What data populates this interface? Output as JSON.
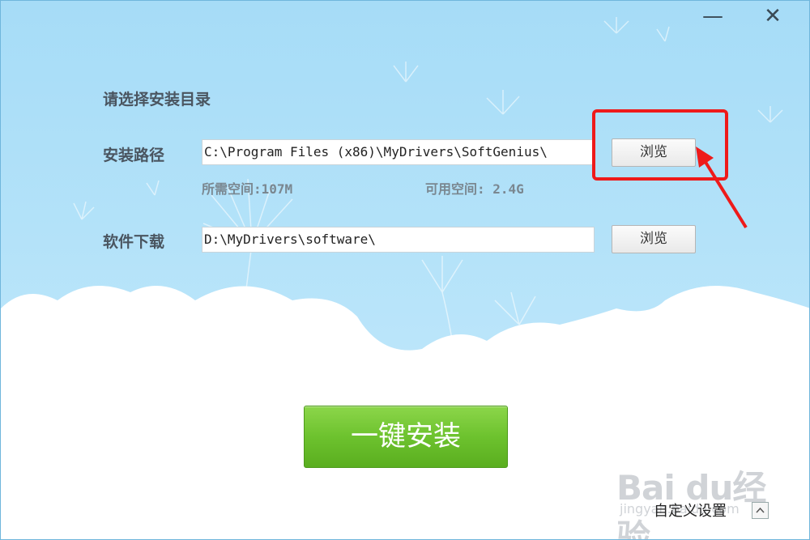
{
  "window": {
    "minimize_symbol": "—",
    "close_symbol": "✕"
  },
  "heading": "请选择安装目录",
  "install_path": {
    "label": "安装路径",
    "value": "C:\\Program Files (x86)\\MyDrivers\\SoftGenius\\",
    "browse_label": "浏览",
    "required_space": "所需空间:107M",
    "available_space": "可用空间: 2.4G"
  },
  "download_path": {
    "label": "软件下载",
    "value": "D:\\MyDrivers\\software\\",
    "browse_label": "浏览"
  },
  "install_button": "一键安装",
  "custom_settings": {
    "label": "自定义设置",
    "toggle_symbol": "^"
  },
  "watermark": {
    "brand": "Bai du经验",
    "url": "jingyan.baidu.com"
  },
  "colors": {
    "sky": "#a6dcf7",
    "install_green": "#6dc22e",
    "highlight_red": "#ee1a1a"
  }
}
